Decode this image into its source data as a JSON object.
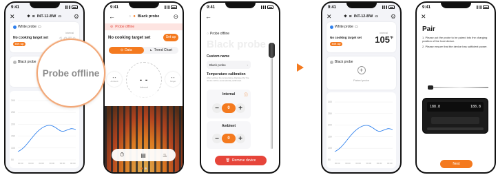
{
  "status_time": "9:41",
  "device_name": "INT-12-BW",
  "magnifier_text": "Probe offline",
  "screen1": {
    "white_probe_label": "White probe",
    "no_target": "No cooking target set",
    "set_up": "Set up",
    "internal_label": "Internal",
    "black_probe_label": "Black probe",
    "chart_x_ticks": [
      "00:00",
      "00:00",
      "00:00",
      "00:00",
      "00:00",
      "00:00"
    ],
    "chart_y_ticks": [
      "300",
      "250",
      "200",
      "150",
      "100",
      "50"
    ]
  },
  "screen2": {
    "title": "Black probe",
    "offline_banner": "Probe offline",
    "no_target": "No cooking target set",
    "set_up": "Set up",
    "tab_data": "Data",
    "tab_trend": "Trend Chart",
    "ambient_label": "Ambient",
    "internal_label": "Internal",
    "target_label": "Target",
    "dash": "- -",
    "big_dash": "- -"
  },
  "screen3": {
    "header": "Probe offline",
    "watermark": "Black probe",
    "custom_name_label": "Custom name",
    "custom_name_value": "Black probe",
    "temp_calibration_label": "Temperature calibration",
    "calibration_desc": "After setting, the temperature displayed by the device will be automatically calibrated.",
    "internal_label": "Internal",
    "internal_value": "0",
    "ambient_label": "Ambient",
    "ambient_value": "0",
    "remove_button": "Remove device"
  },
  "screen4": {
    "white_probe_label": "White probe",
    "no_target": "No cooking target set",
    "set_up": "Set up",
    "internal_label": "Internal",
    "temp_value": "105",
    "temp_unit": "°F",
    "black_probe_label": "Black probe",
    "paired_probe": "Paired probe",
    "chart_x_ticks": [
      "00:00",
      "00:00",
      "00:00",
      "00:00",
      "00:00",
      "00:00"
    ],
    "chart_y_ticks": [
      "300",
      "250",
      "200",
      "150",
      "100",
      "50"
    ]
  },
  "screen5": {
    "title": "Pair",
    "instruction_1": "1. Please put the probe to be paired into the charging position of the host device.",
    "instruction_2": "2. Please ensure that the device has sufficient power.",
    "display_left": "188.8",
    "display_right": "188.8",
    "next_button": "Next"
  },
  "colors": {
    "accent": "#f47a1f",
    "danger": "#e6453a",
    "chart_line": "#2f80ed",
    "offline_bg": "#fde4e1"
  }
}
